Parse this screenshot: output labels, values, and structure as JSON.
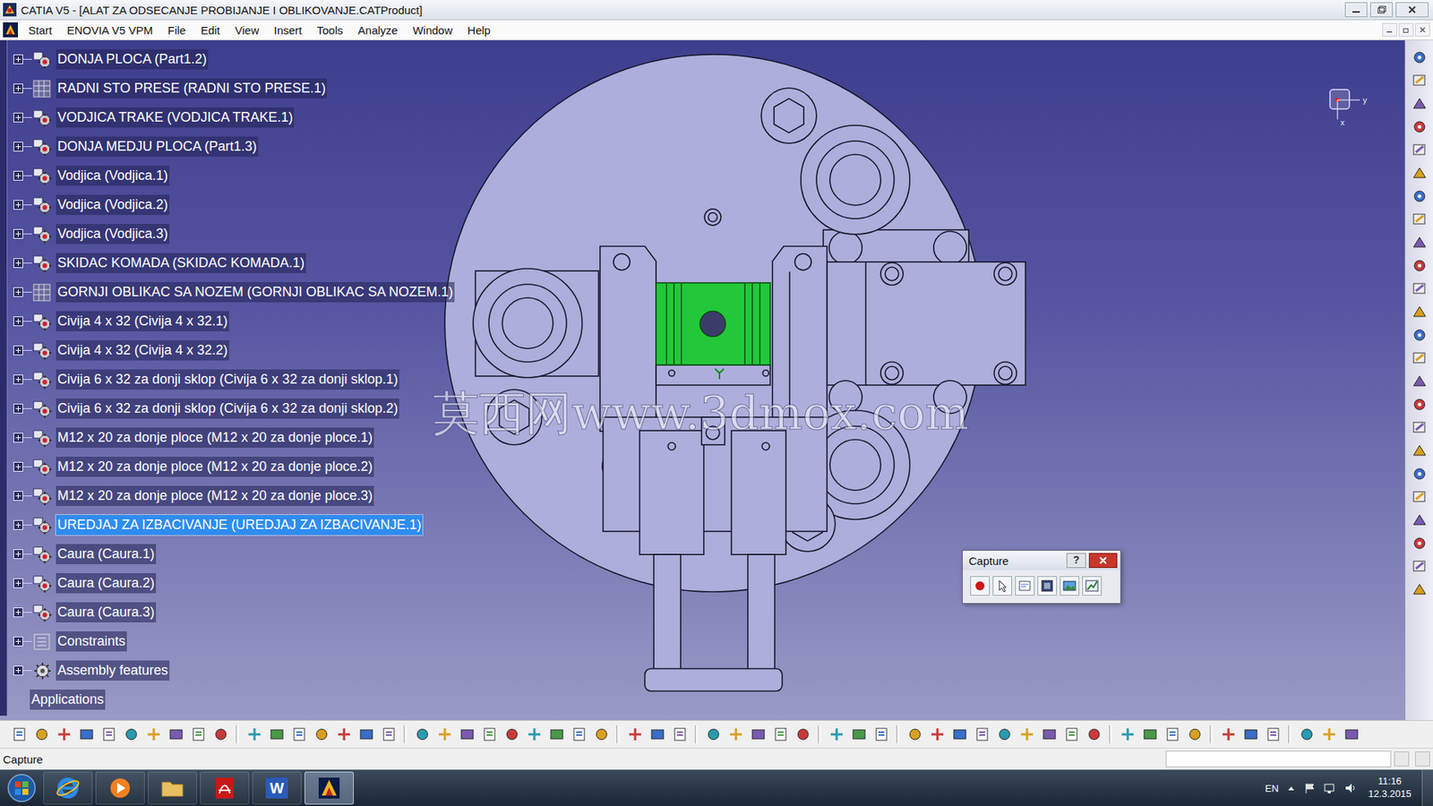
{
  "window": {
    "title": "CATIA V5 - [ALAT ZA ODSECANJE PROBIJANJE I OBLIKOVANJE.CATProduct]"
  },
  "menu": [
    {
      "label": "Start"
    },
    {
      "label": "ENOVIA V5 VPM"
    },
    {
      "label": "File"
    },
    {
      "label": "Edit"
    },
    {
      "label": "View"
    },
    {
      "label": "Insert"
    },
    {
      "label": "Tools"
    },
    {
      "label": "Analyze"
    },
    {
      "label": "Window"
    },
    {
      "label": "Help"
    }
  ],
  "tree": [
    {
      "label": "DONJA PLOCA (Part1.2)",
      "kind": "part",
      "expanded": false,
      "selected": false
    },
    {
      "label": "RADNI STO PRESE (RADNI STO PRESE.1)",
      "kind": "product",
      "expanded": false,
      "selected": false
    },
    {
      "label": "VODJICA TRAKE (VODJICA TRAKE.1)",
      "kind": "part",
      "expanded": false,
      "selected": false
    },
    {
      "label": "DONJA MEDJU PLOCA (Part1.3)",
      "kind": "part",
      "expanded": false,
      "selected": false
    },
    {
      "label": "Vodjica (Vodjica.1)",
      "kind": "part",
      "expanded": false,
      "selected": false
    },
    {
      "label": "Vodjica (Vodjica.2)",
      "kind": "part",
      "expanded": false,
      "selected": false
    },
    {
      "label": "Vodjica (Vodjica.3)",
      "kind": "part",
      "expanded": false,
      "selected": false
    },
    {
      "label": "SKIDAC KOMADA (SKIDAC KOMADA.1)",
      "kind": "part",
      "expanded": false,
      "selected": false
    },
    {
      "label": "GORNJI OBLIKAC SA NOZEM (GORNJI OBLIKAC SA NOZEM.1)",
      "kind": "product",
      "expanded": false,
      "selected": false
    },
    {
      "label": "Civija 4 x 32 (Civija 4 x 32.1)",
      "kind": "part",
      "expanded": false,
      "selected": false
    },
    {
      "label": "Civija 4 x 32 (Civija 4 x 32.2)",
      "kind": "part",
      "expanded": false,
      "selected": false
    },
    {
      "label": "Civija 6 x 32 za donji sklop (Civija 6 x 32 za donji sklop.1)",
      "kind": "part",
      "expanded": false,
      "selected": false
    },
    {
      "label": "Civija 6 x 32 za donji sklop (Civija 6 x 32 za donji sklop.2)",
      "kind": "part",
      "expanded": false,
      "selected": false
    },
    {
      "label": "M12 x 20 za donje ploce (M12 x 20 za donje ploce.1)",
      "kind": "part",
      "expanded": false,
      "selected": false
    },
    {
      "label": "M12 x 20 za donje ploce (M12 x 20 za donje ploce.2)",
      "kind": "part",
      "expanded": false,
      "selected": false
    },
    {
      "label": "M12 x 20 za donje ploce (M12 x 20 za donje ploce.3)",
      "kind": "part",
      "expanded": false,
      "selected": false
    },
    {
      "label": "UREDJAJ ZA IZBACIVANJE (UREDJAJ ZA IZBACIVANJE.1)",
      "kind": "part",
      "expanded": false,
      "selected": true
    },
    {
      "label": "Caura (Caura.1)",
      "kind": "part",
      "expanded": false,
      "selected": false
    },
    {
      "label": "Caura (Caura.2)",
      "kind": "part",
      "expanded": false,
      "selected": false
    },
    {
      "label": "Caura (Caura.3)",
      "kind": "part",
      "expanded": false,
      "selected": false
    },
    {
      "label": "Constraints",
      "kind": "constraints",
      "expanded": false,
      "selected": false
    },
    {
      "label": "Assembly features",
      "kind": "features",
      "expanded": false,
      "selected": false
    },
    {
      "label": "Applications",
      "kind": "applications",
      "expanded": false,
      "selected": false
    }
  ],
  "compass": {
    "y_axis": "y",
    "x_axis": "x"
  },
  "watermark": "莫西网www.3dmox.com",
  "capture_dialog": {
    "title": "Capture",
    "help": "?"
  },
  "status_bar": {
    "text": "Capture"
  },
  "taskbar": {
    "apps": [
      {
        "kind": "browser",
        "selected": false
      },
      {
        "kind": "media",
        "selected": false
      },
      {
        "kind": "folder",
        "selected": false
      },
      {
        "kind": "acrobat",
        "selected": false
      },
      {
        "kind": "word",
        "glyph": "W",
        "selected": false
      },
      {
        "kind": "catia",
        "selected": true
      }
    ],
    "language": "EN",
    "time": "11:16",
    "date": "12.3.2015"
  }
}
